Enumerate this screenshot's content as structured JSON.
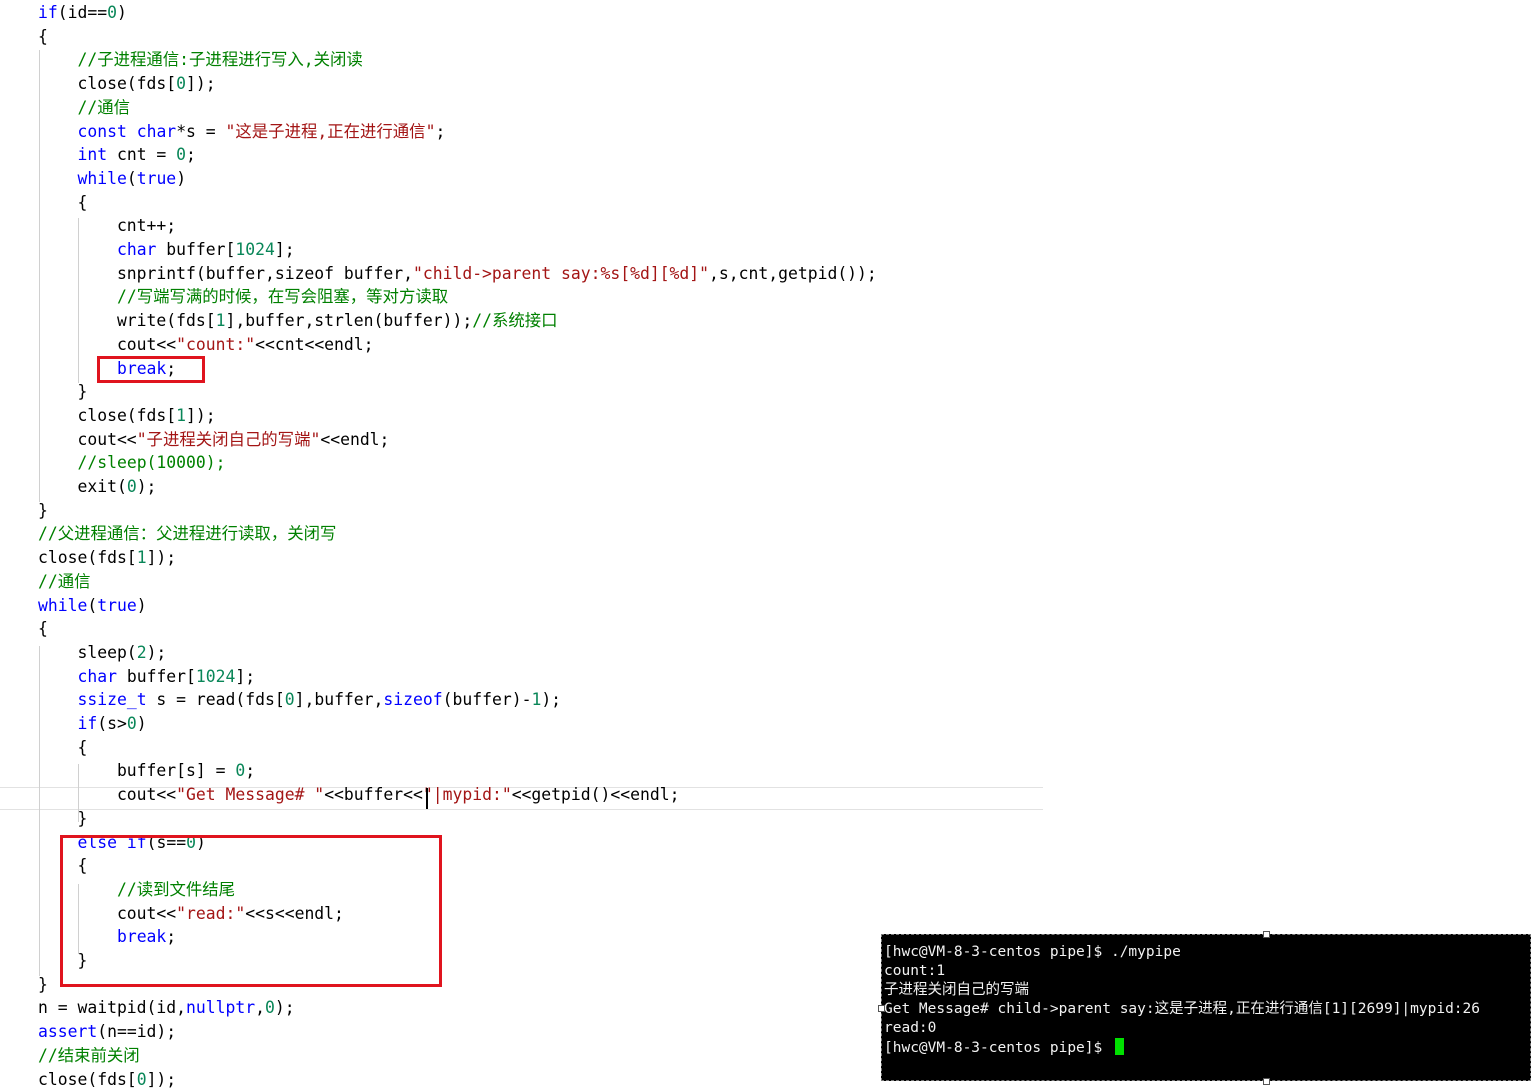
{
  "editor": {
    "lines": [
      {
        "segments": [
          {
            "t": "if",
            "c": "kw"
          },
          {
            "t": "(id==",
            "c": "plain"
          },
          {
            "t": "0",
            "c": "num"
          },
          {
            "t": ")",
            "c": "plain"
          }
        ]
      },
      {
        "segments": [
          {
            "t": "{",
            "c": "plain"
          }
        ]
      },
      {
        "segments": [
          {
            "t": "    ",
            "c": "plain"
          },
          {
            "t": "//子进程通信:子进程进行写入,关闭读",
            "c": "cm"
          }
        ]
      },
      {
        "segments": [
          {
            "t": "    close(fds[",
            "c": "plain"
          },
          {
            "t": "0",
            "c": "num"
          },
          {
            "t": "]);",
            "c": "plain"
          }
        ]
      },
      {
        "segments": [
          {
            "t": "    ",
            "c": "plain"
          },
          {
            "t": "//通信",
            "c": "cm"
          }
        ]
      },
      {
        "segments": [
          {
            "t": "    ",
            "c": "plain"
          },
          {
            "t": "const",
            "c": "kw"
          },
          {
            "t": " ",
            "c": "plain"
          },
          {
            "t": "char",
            "c": "kw"
          },
          {
            "t": "*s = ",
            "c": "plain"
          },
          {
            "t": "\"这是子进程,正在进行通信\"",
            "c": "str"
          },
          {
            "t": ";",
            "c": "plain"
          }
        ]
      },
      {
        "segments": [
          {
            "t": "    ",
            "c": "plain"
          },
          {
            "t": "int",
            "c": "kw"
          },
          {
            "t": " cnt = ",
            "c": "plain"
          },
          {
            "t": "0",
            "c": "num"
          },
          {
            "t": ";",
            "c": "plain"
          }
        ]
      },
      {
        "segments": [
          {
            "t": "    ",
            "c": "plain"
          },
          {
            "t": "while",
            "c": "kw"
          },
          {
            "t": "(",
            "c": "plain"
          },
          {
            "t": "true",
            "c": "kw"
          },
          {
            "t": ")",
            "c": "plain"
          }
        ]
      },
      {
        "segments": [
          {
            "t": "    {",
            "c": "plain"
          }
        ]
      },
      {
        "segments": [
          {
            "t": "        cnt++;",
            "c": "plain"
          }
        ]
      },
      {
        "segments": [
          {
            "t": "        ",
            "c": "plain"
          },
          {
            "t": "char",
            "c": "kw"
          },
          {
            "t": " buffer[",
            "c": "plain"
          },
          {
            "t": "1024",
            "c": "num"
          },
          {
            "t": "];",
            "c": "plain"
          }
        ]
      },
      {
        "segments": [
          {
            "t": "        snprintf(buffer,sizeof buffer,",
            "c": "plain"
          },
          {
            "t": "\"child->parent say:%s[%d][%d]\"",
            "c": "str"
          },
          {
            "t": ",s,cnt,getpid());",
            "c": "plain"
          }
        ]
      },
      {
        "segments": [
          {
            "t": "        ",
            "c": "plain"
          },
          {
            "t": "//写端写满的时候，在写会阻塞，等对方读取",
            "c": "cm"
          }
        ]
      },
      {
        "segments": [
          {
            "t": "        write(fds[",
            "c": "plain"
          },
          {
            "t": "1",
            "c": "num"
          },
          {
            "t": "],buffer,strlen(buffer));",
            "c": "plain"
          },
          {
            "t": "//系统接口",
            "c": "cm"
          }
        ]
      },
      {
        "segments": [
          {
            "t": "        cout<<",
            "c": "plain"
          },
          {
            "t": "\"count:\"",
            "c": "str"
          },
          {
            "t": "<<cnt<<endl;",
            "c": "plain"
          }
        ]
      },
      {
        "segments": [
          {
            "t": "        ",
            "c": "plain"
          },
          {
            "t": "break",
            "c": "kw"
          },
          {
            "t": ";",
            "c": "plain"
          }
        ]
      },
      {
        "segments": [
          {
            "t": "    }",
            "c": "plain"
          }
        ]
      },
      {
        "segments": [
          {
            "t": "    close(fds[",
            "c": "plain"
          },
          {
            "t": "1",
            "c": "num"
          },
          {
            "t": "]);",
            "c": "plain"
          }
        ]
      },
      {
        "segments": [
          {
            "t": "    cout<<",
            "c": "plain"
          },
          {
            "t": "\"子进程关闭自己的写端\"",
            "c": "str"
          },
          {
            "t": "<<endl;",
            "c": "plain"
          }
        ]
      },
      {
        "segments": [
          {
            "t": "    ",
            "c": "plain"
          },
          {
            "t": "//sleep(10000);",
            "c": "cm"
          }
        ]
      },
      {
        "segments": [
          {
            "t": "    exit(",
            "c": "plain"
          },
          {
            "t": "0",
            "c": "num"
          },
          {
            "t": ");",
            "c": "plain"
          }
        ]
      },
      {
        "segments": [
          {
            "t": "}",
            "c": "plain"
          }
        ]
      },
      {
        "segments": [
          {
            "t": "//父进程通信：父进程进行读取，关闭写",
            "c": "cm"
          }
        ]
      },
      {
        "segments": [
          {
            "t": "close(fds[",
            "c": "plain"
          },
          {
            "t": "1",
            "c": "num"
          },
          {
            "t": "]);",
            "c": "plain"
          }
        ]
      },
      {
        "segments": [
          {
            "t": "//通信",
            "c": "cm"
          }
        ]
      },
      {
        "segments": [
          {
            "t": "while",
            "c": "kw"
          },
          {
            "t": "(",
            "c": "plain"
          },
          {
            "t": "true",
            "c": "kw"
          },
          {
            "t": ")",
            "c": "plain"
          }
        ]
      },
      {
        "segments": [
          {
            "t": "{",
            "c": "plain"
          }
        ]
      },
      {
        "segments": [
          {
            "t": "    sleep(",
            "c": "plain"
          },
          {
            "t": "2",
            "c": "num"
          },
          {
            "t": ");",
            "c": "plain"
          }
        ]
      },
      {
        "segments": [
          {
            "t": "    ",
            "c": "plain"
          },
          {
            "t": "char",
            "c": "kw"
          },
          {
            "t": " buffer[",
            "c": "plain"
          },
          {
            "t": "1024",
            "c": "num"
          },
          {
            "t": "];",
            "c": "plain"
          }
        ]
      },
      {
        "segments": [
          {
            "t": "    ",
            "c": "plain"
          },
          {
            "t": "ssize_t",
            "c": "kw"
          },
          {
            "t": " s = read(fds[",
            "c": "plain"
          },
          {
            "t": "0",
            "c": "num"
          },
          {
            "t": "],buffer,",
            "c": "plain"
          },
          {
            "t": "sizeof",
            "c": "kw"
          },
          {
            "t": "(buffer)-",
            "c": "plain"
          },
          {
            "t": "1",
            "c": "num"
          },
          {
            "t": ");",
            "c": "plain"
          }
        ]
      },
      {
        "segments": [
          {
            "t": "    ",
            "c": "plain"
          },
          {
            "t": "if",
            "c": "kw"
          },
          {
            "t": "(s>",
            "c": "plain"
          },
          {
            "t": "0",
            "c": "num"
          },
          {
            "t": ")",
            "c": "plain"
          }
        ]
      },
      {
        "segments": [
          {
            "t": "    {",
            "c": "plain"
          }
        ]
      },
      {
        "segments": [
          {
            "t": "        buffer[s] = ",
            "c": "plain"
          },
          {
            "t": "0",
            "c": "num"
          },
          {
            "t": ";",
            "c": "plain"
          }
        ]
      },
      {
        "segments": [
          {
            "t": "        cout<<",
            "c": "plain"
          },
          {
            "t": "\"Get Message# \"",
            "c": "str"
          },
          {
            "t": "<<buffer<<",
            "c": "plain"
          },
          {
            "t": "\"|mypid:\"",
            "c": "str"
          },
          {
            "t": "<<getpid()<<endl;",
            "c": "plain"
          }
        ]
      },
      {
        "segments": [
          {
            "t": "    }",
            "c": "plain"
          }
        ]
      },
      {
        "segments": [
          {
            "t": "    ",
            "c": "plain"
          },
          {
            "t": "else",
            "c": "kw"
          },
          {
            "t": " ",
            "c": "plain"
          },
          {
            "t": "if",
            "c": "kw"
          },
          {
            "t": "(s==",
            "c": "plain"
          },
          {
            "t": "0",
            "c": "num"
          },
          {
            "t": ")",
            "c": "plain"
          }
        ]
      },
      {
        "segments": [
          {
            "t": "    {",
            "c": "plain"
          }
        ]
      },
      {
        "segments": [
          {
            "t": "        ",
            "c": "plain"
          },
          {
            "t": "//读到文件结尾",
            "c": "cm"
          }
        ]
      },
      {
        "segments": [
          {
            "t": "        cout<<",
            "c": "plain"
          },
          {
            "t": "\"read:\"",
            "c": "str"
          },
          {
            "t": "<<s<<endl;",
            "c": "plain"
          }
        ]
      },
      {
        "segments": [
          {
            "t": "        ",
            "c": "plain"
          },
          {
            "t": "break",
            "c": "kw"
          },
          {
            "t": ";",
            "c": "plain"
          }
        ]
      },
      {
        "segments": [
          {
            "t": "    }",
            "c": "plain"
          }
        ]
      },
      {
        "segments": [
          {
            "t": "}",
            "c": "plain"
          }
        ]
      },
      {
        "segments": [
          {
            "t": "n = waitpid(id,",
            "c": "plain"
          },
          {
            "t": "nullptr",
            "c": "kw"
          },
          {
            "t": ",",
            "c": "plain"
          },
          {
            "t": "0",
            "c": "num"
          },
          {
            "t": ");",
            "c": "plain"
          }
        ]
      },
      {
        "segments": [
          {
            "t": "assert",
            "c": "kw"
          },
          {
            "t": "(n==id);",
            "c": "plain"
          }
        ]
      },
      {
        "segments": [
          {
            "t": "//结束前关闭",
            "c": "cm"
          }
        ]
      },
      {
        "segments": [
          {
            "t": "close(fds[",
            "c": "plain"
          },
          {
            "t": "0",
            "c": "num"
          },
          {
            "t": "]);",
            "c": "plain"
          }
        ]
      }
    ],
    "colors": {
      "keyword": "#0000ff",
      "comment": "#008000",
      "string": "#a31515",
      "number": "#098658",
      "plain": "#000000",
      "highlight_box": "#e0141e"
    }
  },
  "terminal": {
    "lines": [
      "[hwc@VM-8-3-centos pipe]$ ./mypipe",
      "count:1",
      "子进程关闭自己的写端",
      "Get Message# child->parent say:这是子进程,正在进行通信[1][2699]|mypid:26",
      "read:0",
      "[hwc@VM-8-3-centos pipe]$ "
    ],
    "background": "#000000",
    "foreground": "#f2f2f2",
    "cursor_color": "#00e000"
  }
}
